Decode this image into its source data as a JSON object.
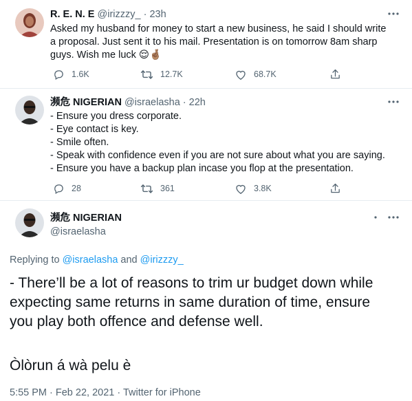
{
  "tweet1": {
    "display_name": "R. E. N. E",
    "handle": "@irizzzy_",
    "separator": "·",
    "time": "23h",
    "text": "Asked my husband for money to start a new business, he said I should write a proposal. Just sent it to his mail. Presentation is on tomorrow 8am sharp guys. Wish me luck 😌🤞🏽",
    "actions": {
      "reply_count": "1.6K",
      "retweet_count": "12.7K",
      "like_count": "68.7K"
    }
  },
  "tweet2": {
    "display_name": "瀕危 NIGERIAN",
    "handle": "@israelasha",
    "separator": "·",
    "time": "22h",
    "lines": [
      "- Ensure you dress corporate.",
      "- Eye contact is key.",
      "- Smile often.",
      "- Speak with confidence even if you are not sure about what you are saying.",
      "- Ensure you have a backup plan incase you flop at the presentation."
    ],
    "actions": {
      "reply_count": "28",
      "retweet_count": "361",
      "like_count": "3.8K"
    }
  },
  "main_tweet": {
    "display_name": "瀕危 NIGERIAN",
    "handle": "@israelasha",
    "replying_prefix": "Replying to",
    "mention1": "@israelasha",
    "conj": "and",
    "mention2": "@irizzzy_",
    "text_para1": "- There’ll be a lot of reasons to trim ur budget down while expecting same returns in same duration of time, ensure you play both offence and defense well.",
    "text_para2": "Òlòrun á wà pelu è",
    "timestamp": "5:55 PM · Feb 22, 2021 · Twitter for iPhone"
  },
  "icons": {
    "reply": "reply-icon",
    "retweet": "retweet-icon",
    "like": "heart-icon",
    "share": "share-icon",
    "more": "more-icon"
  },
  "colors": {
    "icon_gray": "#536471",
    "link_blue": "#1d9bf0",
    "divider": "#e6ecf0"
  }
}
